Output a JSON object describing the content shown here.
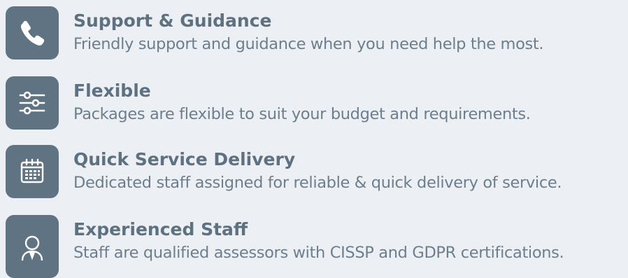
{
  "features": [
    {
      "icon": "phone-icon",
      "title": "Support & Guidance",
      "description": "Friendly support and guidance when you need help the most."
    },
    {
      "icon": "sliders-icon",
      "title": "Flexible",
      "description": "Packages are flexible to suit your budget and requirements."
    },
    {
      "icon": "calendar-icon",
      "title": "Quick Service Delivery",
      "description": "Dedicated staff assigned for reliable & quick delivery of service."
    },
    {
      "icon": "user-icon",
      "title": "Experienced Staff",
      "description": "Staff are qualified assessors with CISSP and GDPR certifications."
    }
  ],
  "colors": {
    "background": "#eceff3",
    "icon_tile": "#607383",
    "title": "#5e7181",
    "description": "#6d7e8d"
  }
}
